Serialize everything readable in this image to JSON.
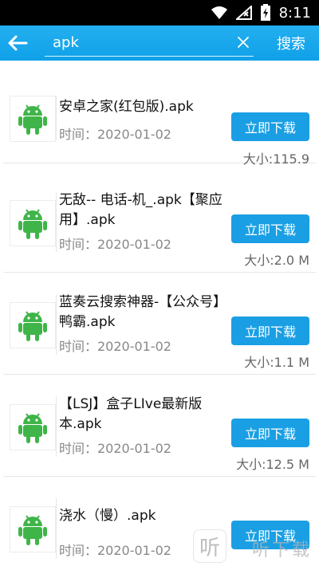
{
  "status_bar": {
    "time": "8:11"
  },
  "toolbar": {
    "search_value": "apk",
    "search_button": "搜索"
  },
  "results": [
    {
      "name": "安卓之家(红包版).apk",
      "time": "时间：2020-01-02",
      "button": "立即下载",
      "size": "大小:115.9"
    },
    {
      "name": "无敌-- 电话-机_.apk【聚应用】.apk",
      "time": "时间：2020-01-02",
      "button": "立即下载",
      "size": "大小:2.0 M"
    },
    {
      "name": "蓝奏云搜索神器-【公众号】鸭霸.apk",
      "time": "时间：2020-01-02",
      "button": "立即下载",
      "size": "大小:1.1 M"
    },
    {
      "name": "【LSJ】盒子LIve最新版本.apk",
      "time": "时间：2020-01-02",
      "button": "立即下载",
      "size": "大小:12.5 M"
    },
    {
      "name": "浇水（慢）.apk",
      "time": "时间：2020-01-02",
      "button": "立即下载",
      "size": ""
    }
  ],
  "watermark": {
    "icon_glyph": "听",
    "text": "听下载"
  },
  "colors": {
    "accent": "#1a9fe4",
    "android_green": "#3fb549"
  },
  "icons": {
    "back": "arrow-left-icon",
    "clear": "close-icon",
    "app": "android-icon"
  }
}
